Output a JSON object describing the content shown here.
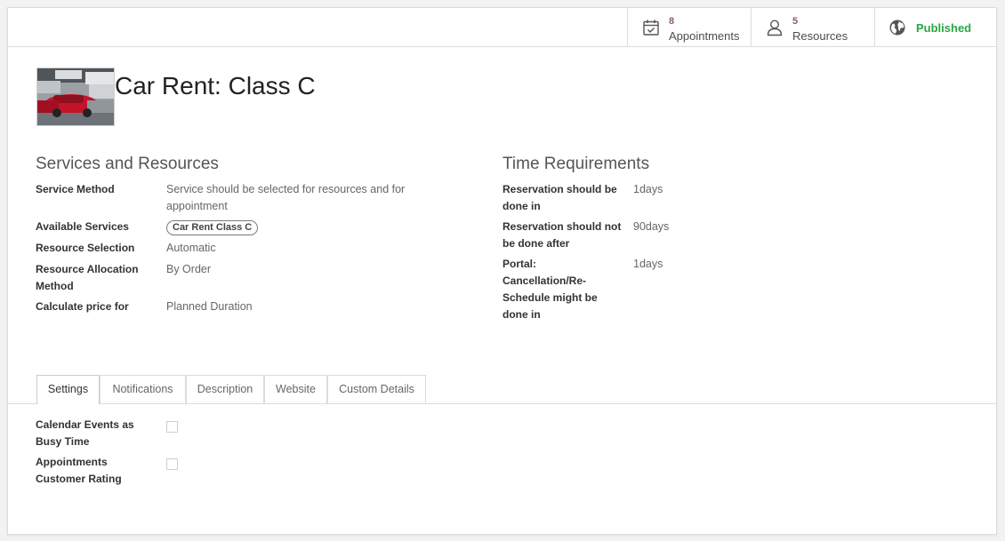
{
  "smart_buttons": {
    "appointments": {
      "count": "8",
      "label": "Appointments",
      "icon": "calendar-check-icon"
    },
    "resources": {
      "count": "5",
      "label": "Resources",
      "icon": "user-icon"
    },
    "published": {
      "label": "Published",
      "icon": "globe-icon",
      "color": "#28a745"
    }
  },
  "record": {
    "title": "Car Rent: Class C"
  },
  "services": {
    "title": "Services and Resources",
    "fields": [
      {
        "label": "Service Method",
        "value": "Service should be selected for resources and for appointment"
      },
      {
        "label": "Available Services",
        "value": "Car Rent Class C"
      },
      {
        "label": "Resource Selection",
        "value": "Automatic"
      },
      {
        "label": "Resource Allocation Method",
        "value": "By Order"
      },
      {
        "label": "Calculate price for",
        "value": "Planned Duration"
      }
    ]
  },
  "time": {
    "title": "Time Requirements",
    "fields": [
      {
        "label": "Reservation should be done in",
        "value": "1days"
      },
      {
        "label": "Reservation should not be done after",
        "value": "90days"
      },
      {
        "label": "Portal: Cancellation/Re-Schedule might be done in",
        "value": "1days"
      }
    ]
  },
  "tabs": [
    "Settings",
    "Notifications",
    "Description",
    "Website",
    "Custom Details"
  ],
  "settings": {
    "fields": [
      {
        "label": "Calendar Events as Busy Time",
        "checked": false
      },
      {
        "label": "Appointments Customer Rating",
        "checked": false
      }
    ]
  },
  "colors": {
    "accent": "#875a7b",
    "published": "#28a745"
  }
}
